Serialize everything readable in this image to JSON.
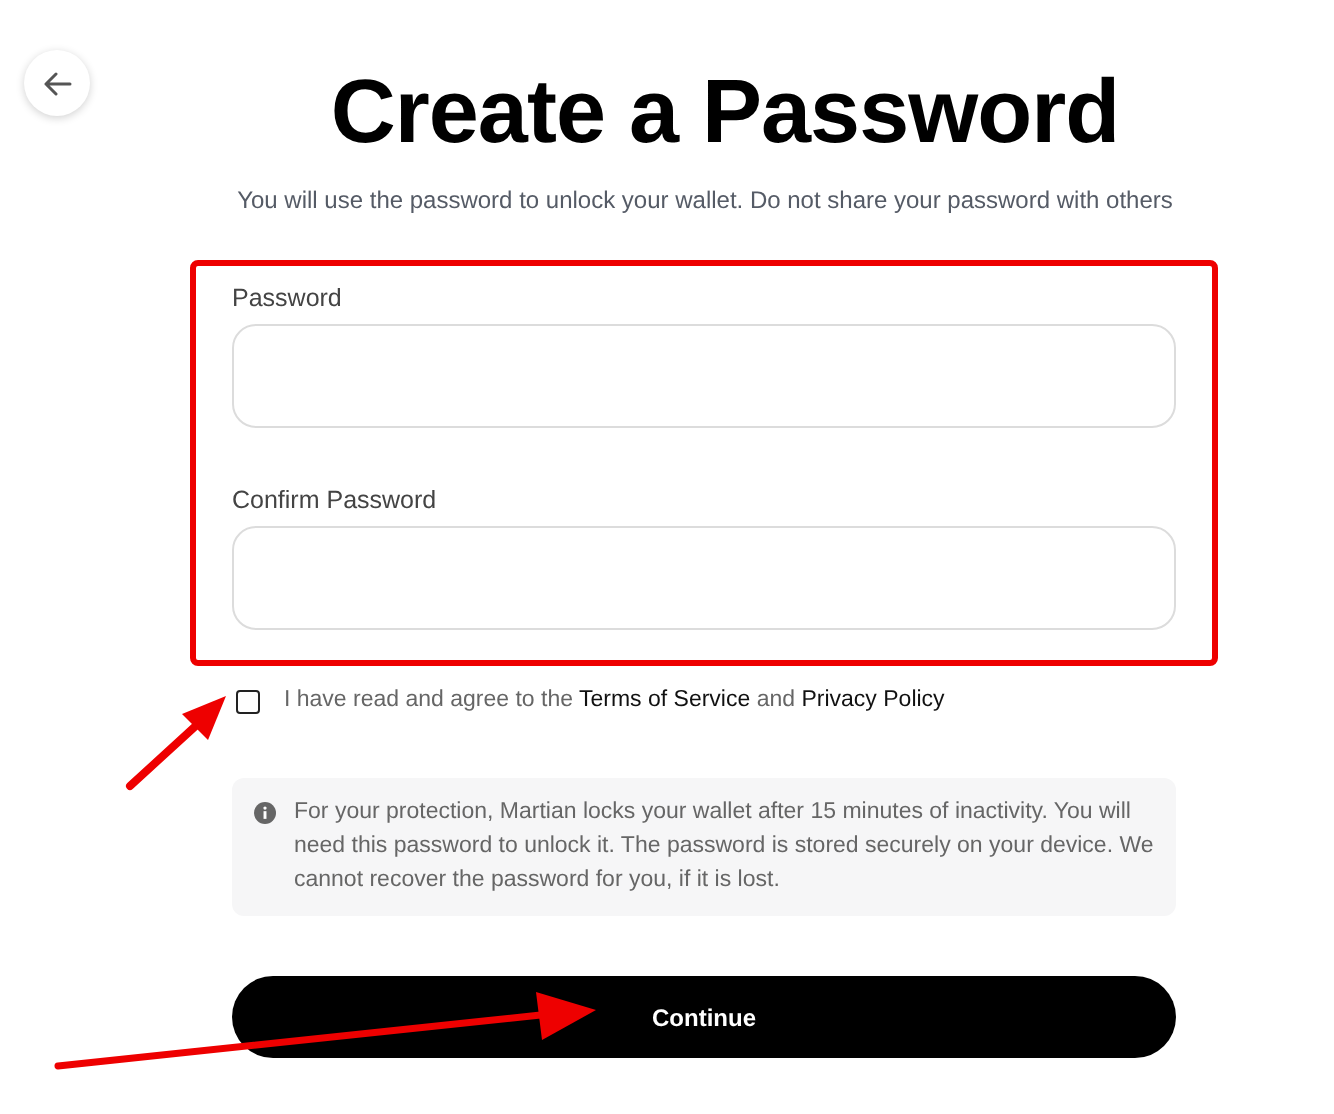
{
  "title": "Create a Password",
  "subtitle": "You will use the password to unlock your wallet. Do not share your password with others",
  "fields": [
    {
      "label": "Password"
    },
    {
      "label": "Confirm Password"
    }
  ],
  "agreement": {
    "checked": false,
    "lead": "I have read and agree to the",
    "terms_link": "Terms of Service",
    "joiner": "and",
    "privacy_link": "Privacy Policy"
  },
  "notice": "For your protection, Martian locks your wallet after 15 minutes of inactivity. You will need this password to unlock it. The password is stored securely on your device. We cannot recover the password for you, if it is lost.",
  "continue_button": "Continue"
}
